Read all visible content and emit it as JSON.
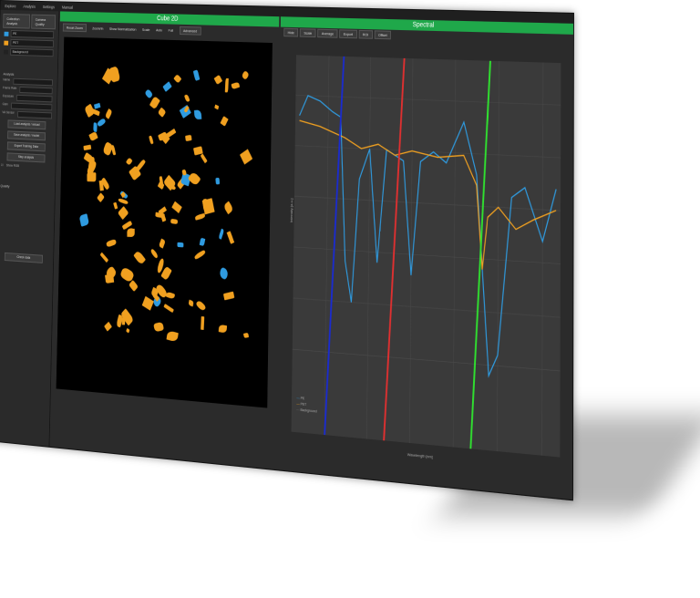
{
  "menu": [
    "Explore",
    "Analysis",
    "Settings",
    "Manual"
  ],
  "left_panel": {
    "tabs": [
      "Collection Analysis",
      "Camera Quality"
    ],
    "materials": [
      {
        "name": "PE",
        "color": "#2f9be0"
      },
      {
        "name": "PET",
        "color": "#f0a020"
      },
      {
        "name": "Background",
        "color": "#222222"
      }
    ],
    "section_title": "Analysis",
    "fields": [
      "Name",
      "Frame Rate",
      "Exposure",
      "Gain",
      "VA Sensor"
    ],
    "buttons": [
      "Load analysis / reload",
      "Save analysis / model",
      "Export Training Data",
      "Stop analysis"
    ],
    "show_rgb": "Show RGB",
    "quality_title": "Quality",
    "bottom_button": "Check data"
  },
  "cube": {
    "title": "Cube 2D",
    "toolbar": {
      "reset": "Reset Zoom",
      "zoom": "Zoom/In",
      "show": "Show Normalization",
      "scale": "Scale",
      "auto": "Auto",
      "full": "Full",
      "advanced": "Advanced"
    }
  },
  "spectral": {
    "title": "Spectral",
    "tabs": [
      "Hide",
      "Scale",
      "Average",
      "Export",
      "ROI",
      "Offset"
    ],
    "legend": [
      "PE",
      "PET",
      "Background"
    ],
    "xlabel": "Wavelength [nm]",
    "ylabel": "Intensity [a.u.]"
  },
  "colors": {
    "accent": "#1fa84a",
    "pe": "#2f9be0",
    "pet": "#f0a020"
  }
}
